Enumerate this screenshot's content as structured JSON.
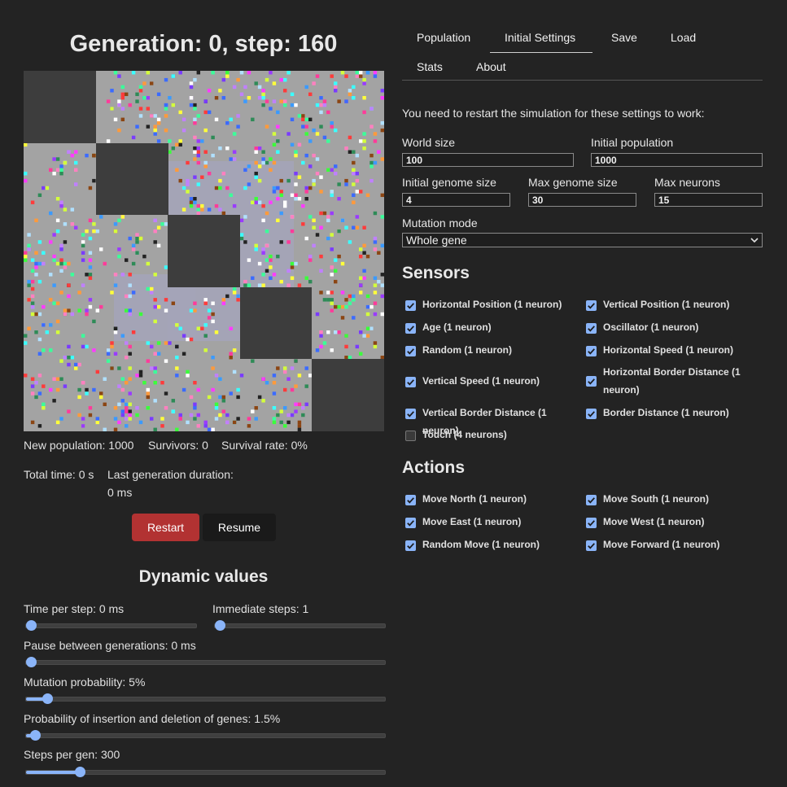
{
  "header": {
    "generation_title": "Generation: 0, step: 160"
  },
  "stats": {
    "new_population": "New population: 1000",
    "survivors": "Survivors: 0",
    "survival_rate": "Survival rate: 0%",
    "total_time": "Total time: 0 s",
    "last_gen_label": "Last generation duration:",
    "last_gen_value": "0 ms"
  },
  "buttons": {
    "restart": "Restart",
    "resume": "Resume"
  },
  "dynamic": {
    "title": "Dynamic values",
    "time_per_step": {
      "label": "Time per step: 0 ms",
      "value": 0
    },
    "immediate_steps": {
      "label": "Immediate steps: 1",
      "value": 0
    },
    "pause": {
      "label": "Pause between generations: 0 ms",
      "value": 0
    },
    "mutation": {
      "label": "Mutation probability: 5%",
      "value": 0.06
    },
    "insert_delete": {
      "label": "Probability of insertion and deletion of genes: 1.5%",
      "value": 0.025
    },
    "steps_per_gen": {
      "label": "Steps per gen: 300",
      "value": 0.15
    }
  },
  "tabs": [
    "Population",
    "Initial Settings",
    "Save",
    "Load",
    "Stats",
    "About"
  ],
  "active_tab": "Initial Settings",
  "settings": {
    "notice": "You need to restart the simulation for these settings to work:",
    "world_size": {
      "label": "World size",
      "value": "100"
    },
    "initial_population": {
      "label": "Initial population",
      "value": "1000"
    },
    "initial_genome_size": {
      "label": "Initial genome size",
      "value": "4"
    },
    "max_genome_size": {
      "label": "Max genome size",
      "value": "30"
    },
    "max_neurons": {
      "label": "Max neurons",
      "value": "15"
    },
    "mutation_mode": {
      "label": "Mutation mode",
      "value": "Whole gene"
    }
  },
  "sensors": {
    "title": "Sensors",
    "items": [
      {
        "label": "Horizontal Position (1 neuron)",
        "checked": true
      },
      {
        "label": "Vertical Position (1 neuron)",
        "checked": true
      },
      {
        "label": "Age (1 neuron)",
        "checked": true
      },
      {
        "label": "Oscillator (1 neuron)",
        "checked": true
      },
      {
        "label": "Random (1 neuron)",
        "checked": true
      },
      {
        "label": "Horizontal Speed (1 neuron)",
        "checked": true
      },
      {
        "label": "Vertical Speed (1 neuron)",
        "checked": true
      },
      {
        "label": "Horizontal Border Distance (1 neuron)",
        "checked": true
      },
      {
        "label": "Vertical Border Distance (1 neuron)",
        "checked": true
      },
      {
        "label": "Border Distance (1 neuron)",
        "checked": true
      },
      {
        "label": "Touch (4 neurons)",
        "checked": false
      }
    ]
  },
  "actions": {
    "title": "Actions",
    "items": [
      {
        "label": "Move North (1 neuron)",
        "checked": true
      },
      {
        "label": "Move South (1 neuron)",
        "checked": true
      },
      {
        "label": "Move East (1 neuron)",
        "checked": true
      },
      {
        "label": "Move West (1 neuron)",
        "checked": true
      },
      {
        "label": "Random Move (1 neuron)",
        "checked": true
      },
      {
        "label": "Move Forward (1 neuron)",
        "checked": true
      }
    ]
  },
  "colors": {
    "accent": "#8ab4f8",
    "restart": "#b23232",
    "background": "#232323",
    "world_bg": "#a3a3a3",
    "wall": "#3d3d3d",
    "safe_zone": "#a4a4b8"
  }
}
